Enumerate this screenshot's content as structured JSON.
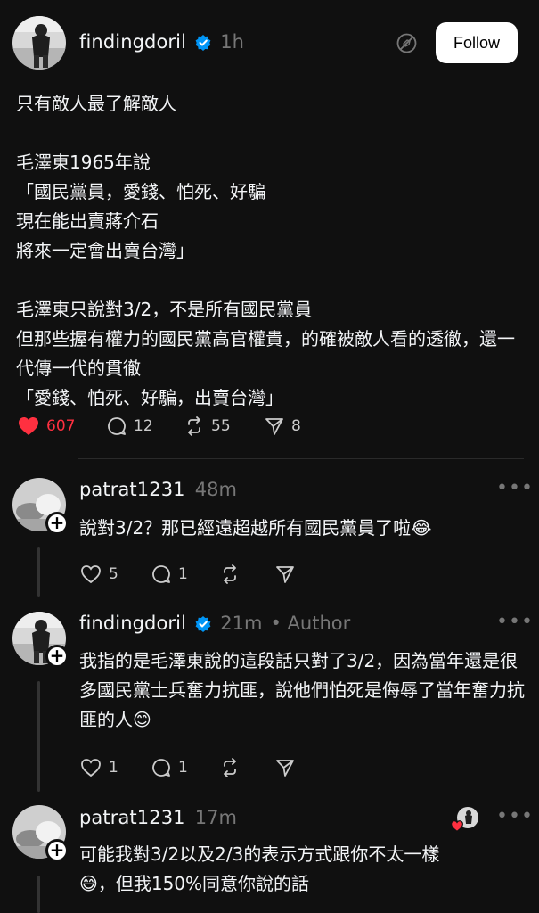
{
  "post": {
    "username": "findingdoril",
    "time": "1h",
    "follow_label": "Follow",
    "text": "只有敵人最了解敵人\n\n毛澤東1965年說\n「國民黨員，愛錢、怕死、好騙\n現在能出賣蔣介石\n將來一定會出賣台灣」\n\n毛澤東只說對3/2，不是所有國民黨員\n但那些握有權力的國民黨高官權貴，的確被敵人看的透徹，還一代傳一代的貫徹\n「愛錢、怕死、好騙，出賣台灣」",
    "likes": "607",
    "comments": "12",
    "reposts": "55",
    "shares": "8",
    "liked_color": "#ff3040"
  },
  "replies": [
    {
      "username": "patrat1231",
      "time": "48m",
      "author_tag": "",
      "text": "說對3/2？那已經遠超越所有國民黨員了啦😂",
      "likes": "5",
      "comments": "1"
    },
    {
      "username": "findingdoril",
      "time": "21m",
      "author_tag": "• Author",
      "text": "我指的是毛澤東說的這段話只對了3/2，因為當年還是很多國民黨士兵奮力抗匪，說他們怕死是侮辱了當年奮力抗匪的人😊",
      "likes": "1",
      "comments": "1"
    },
    {
      "username": "patrat1231",
      "time": "17m",
      "author_tag": "",
      "text": "可能我對3/2以及2/3的表示方式跟你不太一樣\n😅，但我150%同意你說的話"
    }
  ],
  "more_icon": "•••",
  "colors": {
    "background": "#101010",
    "verified": "#0095f6"
  }
}
